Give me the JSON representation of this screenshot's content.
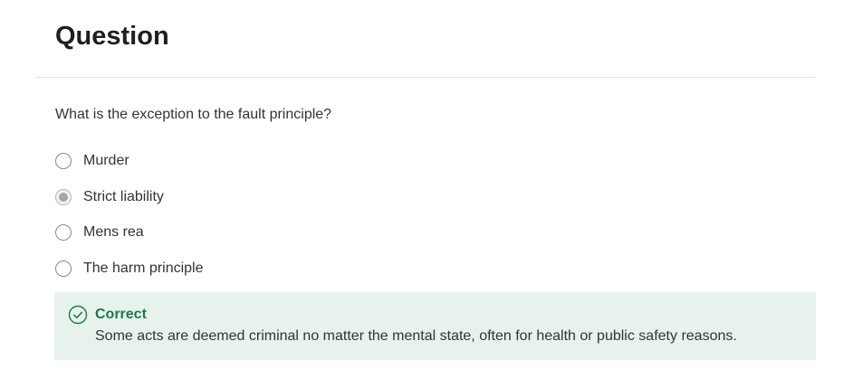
{
  "header": {
    "title": "Question"
  },
  "question": {
    "prompt": "What is the exception to the fault principle?",
    "selected_index": 1,
    "options": [
      {
        "label": "Murder",
        "selected": false
      },
      {
        "label": "Strict liability",
        "selected": true
      },
      {
        "label": "Mens rea",
        "selected": false
      },
      {
        "label": "The harm principle",
        "selected": false
      }
    ]
  },
  "feedback": {
    "status": "Correct",
    "icon": "check-circle-icon",
    "message": "Some acts are deemed criminal no matter the mental state, often for health or public safety reasons.",
    "colors": {
      "accent": "#1d7a46",
      "background": "#e7f2ec"
    }
  }
}
